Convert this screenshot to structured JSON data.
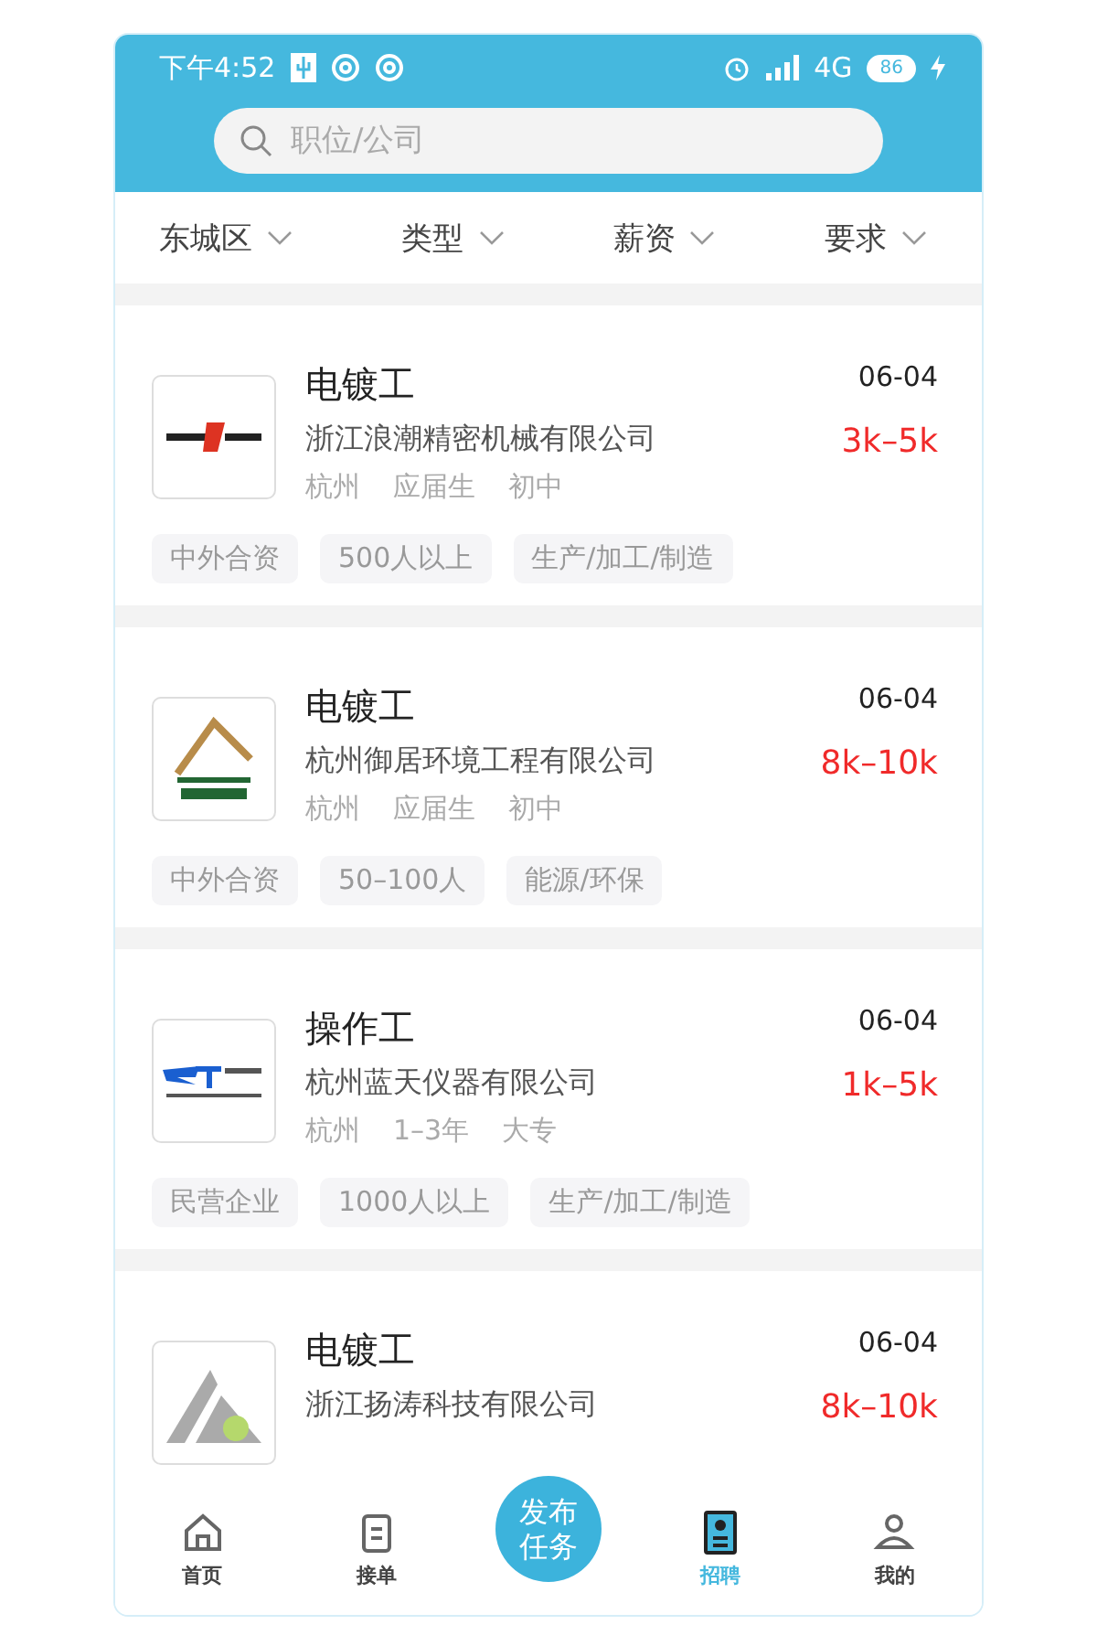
{
  "status_bar": {
    "time": "下午4:52",
    "network": "4G",
    "battery": "86"
  },
  "search": {
    "placeholder": "职位/公司"
  },
  "filters": [
    {
      "label": "东城区"
    },
    {
      "label": "类型"
    },
    {
      "label": "薪资"
    },
    {
      "label": "要求"
    }
  ],
  "jobs": [
    {
      "title": "电镀工",
      "company": "浙江浪潮精密机械有限公司",
      "meta": [
        "杭州",
        "应届生",
        "初中"
      ],
      "date": "06-04",
      "salary": "3k–5k",
      "tags": [
        "中外合资",
        "500人以上",
        "生产/加工/制造"
      ]
    },
    {
      "title": "电镀工",
      "company": "杭州御居环境工程有限公司",
      "meta": [
        "杭州",
        "应届生",
        "初中"
      ],
      "date": "06-04",
      "salary": "8k–10k",
      "tags": [
        "中外合资",
        "50–100人",
        "能源/环保"
      ]
    },
    {
      "title": "操作工",
      "company": "杭州蓝天仪器有限公司",
      "meta": [
        "杭州",
        "1–3年",
        "大专"
      ],
      "date": "06-04",
      "salary": "1k–5k",
      "tags": [
        "民营企业",
        "1000人以上",
        "生产/加工/制造"
      ]
    },
    {
      "title": "电镀工",
      "company": "浙江扬涛科技有限公司",
      "date": "06-04",
      "salary": "8k–10k"
    }
  ],
  "tab_bar": [
    {
      "kind": "tab",
      "label": "首页",
      "selected": false
    },
    {
      "kind": "tab",
      "label": "接单",
      "selected": false
    },
    {
      "kind": "publish",
      "label": "发布任务"
    },
    {
      "kind": "tab",
      "label": "招聘",
      "selected": true
    },
    {
      "kind": "tab",
      "label": "我的",
      "selected": false
    }
  ]
}
